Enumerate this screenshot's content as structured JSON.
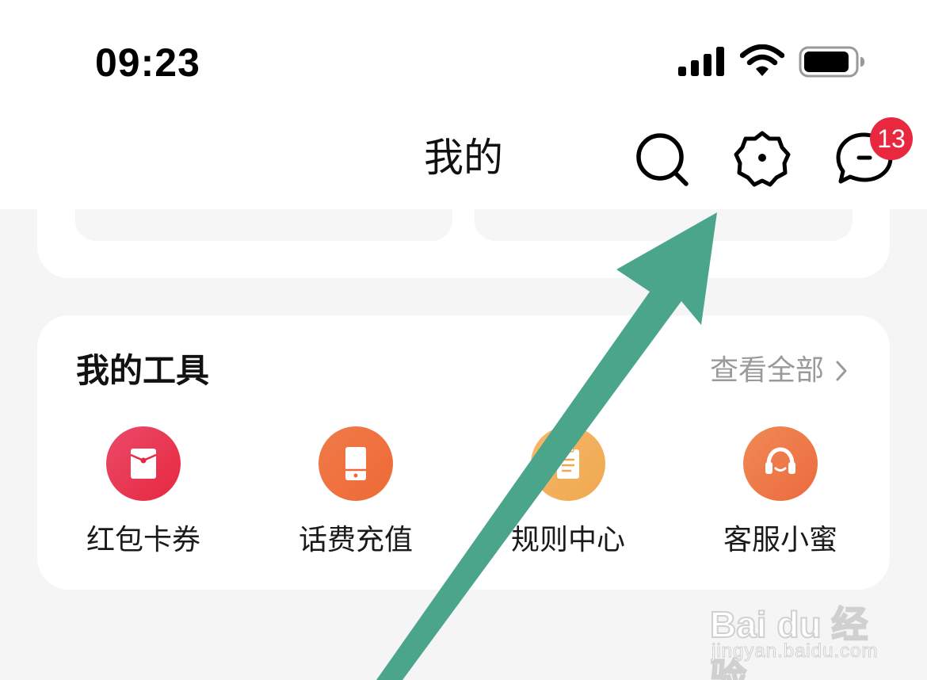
{
  "status_bar": {
    "time": "09:23",
    "icons": [
      "signal-icon",
      "wifi-icon",
      "battery-icon"
    ]
  },
  "nav": {
    "title": "我的",
    "actions": [
      "search-icon",
      "settings-icon",
      "message-icon"
    ],
    "message_badge": "13"
  },
  "tools": {
    "title": "我的工具",
    "view_all": "查看全部",
    "items": [
      {
        "label": "红包卡券",
        "icon": "coupon-envelope-icon",
        "color_start": "#ea4a6a",
        "color_end": "#e8283f"
      },
      {
        "label": "话费充值",
        "icon": "phone-topup-icon",
        "color_start": "#f07a4a",
        "color_end": "#ee6a35"
      },
      {
        "label": "规则中心",
        "icon": "document-icon",
        "color_start": "#f5b86a",
        "color_end": "#f0a84f"
      },
      {
        "label": "客服小蜜",
        "icon": "headset-icon",
        "color_start": "#f08a55",
        "color_end": "#ec6a3e"
      }
    ]
  },
  "overlay": {
    "arrow_color": "#4aa58a"
  },
  "watermark": {
    "logo": "Bai du 经验",
    "url": "jingyan.baidu.com"
  },
  "colors": {
    "background": "#f5f5f5",
    "badge": "#e8283f",
    "muted_text": "#9a9a9a"
  }
}
